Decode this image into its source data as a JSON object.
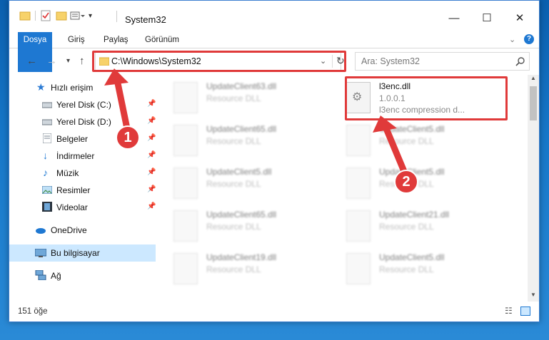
{
  "window": {
    "title": "System32",
    "minimize": "—",
    "maximize": "☐",
    "close": "✕"
  },
  "ribbon": {
    "tabs": [
      "Dosya",
      "Giriş",
      "Paylaş",
      "Görünüm"
    ]
  },
  "nav": {
    "address": "C:\\Windows\\System32",
    "search_placeholder": "Ara: System32"
  },
  "sidebar": {
    "items": [
      {
        "label": "Hızlı erişim",
        "icon": "star-icon"
      },
      {
        "label": "Yerel Disk (C:)",
        "icon": "drive-icon"
      },
      {
        "label": "Yerel Disk (D:)",
        "icon": "drive-icon"
      },
      {
        "label": "Belgeler",
        "icon": "documents-icon"
      },
      {
        "label": "İndirmeler",
        "icon": "download-icon"
      },
      {
        "label": "Müzik",
        "icon": "music-icon"
      },
      {
        "label": "Resimler",
        "icon": "pictures-icon"
      },
      {
        "label": "Videolar",
        "icon": "video-icon"
      },
      {
        "label": "OneDrive",
        "icon": "cloud-icon"
      },
      {
        "label": "Bu bilgisayar",
        "icon": "computer-icon"
      },
      {
        "label": "Ağ",
        "icon": "network-icon"
      }
    ]
  },
  "files": [
    {
      "name": "UpdateClient63.dll",
      "sub": "Resource DLL"
    },
    {
      "name": "l3enc.dll",
      "sub": "1.0.0.1",
      "sub2": "l3enc compression d..."
    },
    {
      "name": "UpdateClient65.dll",
      "sub": "Resource DLL"
    },
    {
      "name": "UpdateClient5.dll",
      "sub": "Resource DLL"
    },
    {
      "name": "UpdateClient5.dll",
      "sub": "Resource DLL"
    },
    {
      "name": "UpdateClient5.dll",
      "sub": "Resource DLL"
    },
    {
      "name": "UpdateClient65.dll",
      "sub": "Resource DLL"
    },
    {
      "name": "UpdateClient21.dll",
      "sub": "Resource DLL"
    },
    {
      "name": "UpdateClient19.dll",
      "sub": "Resource DLL"
    },
    {
      "name": "UpdateClient5.dll",
      "sub": "Resource DLL"
    }
  ],
  "status": {
    "count": "151 öğe"
  },
  "annotations": {
    "badge1": "1",
    "badge2": "2",
    "color": "#e03a3a"
  }
}
